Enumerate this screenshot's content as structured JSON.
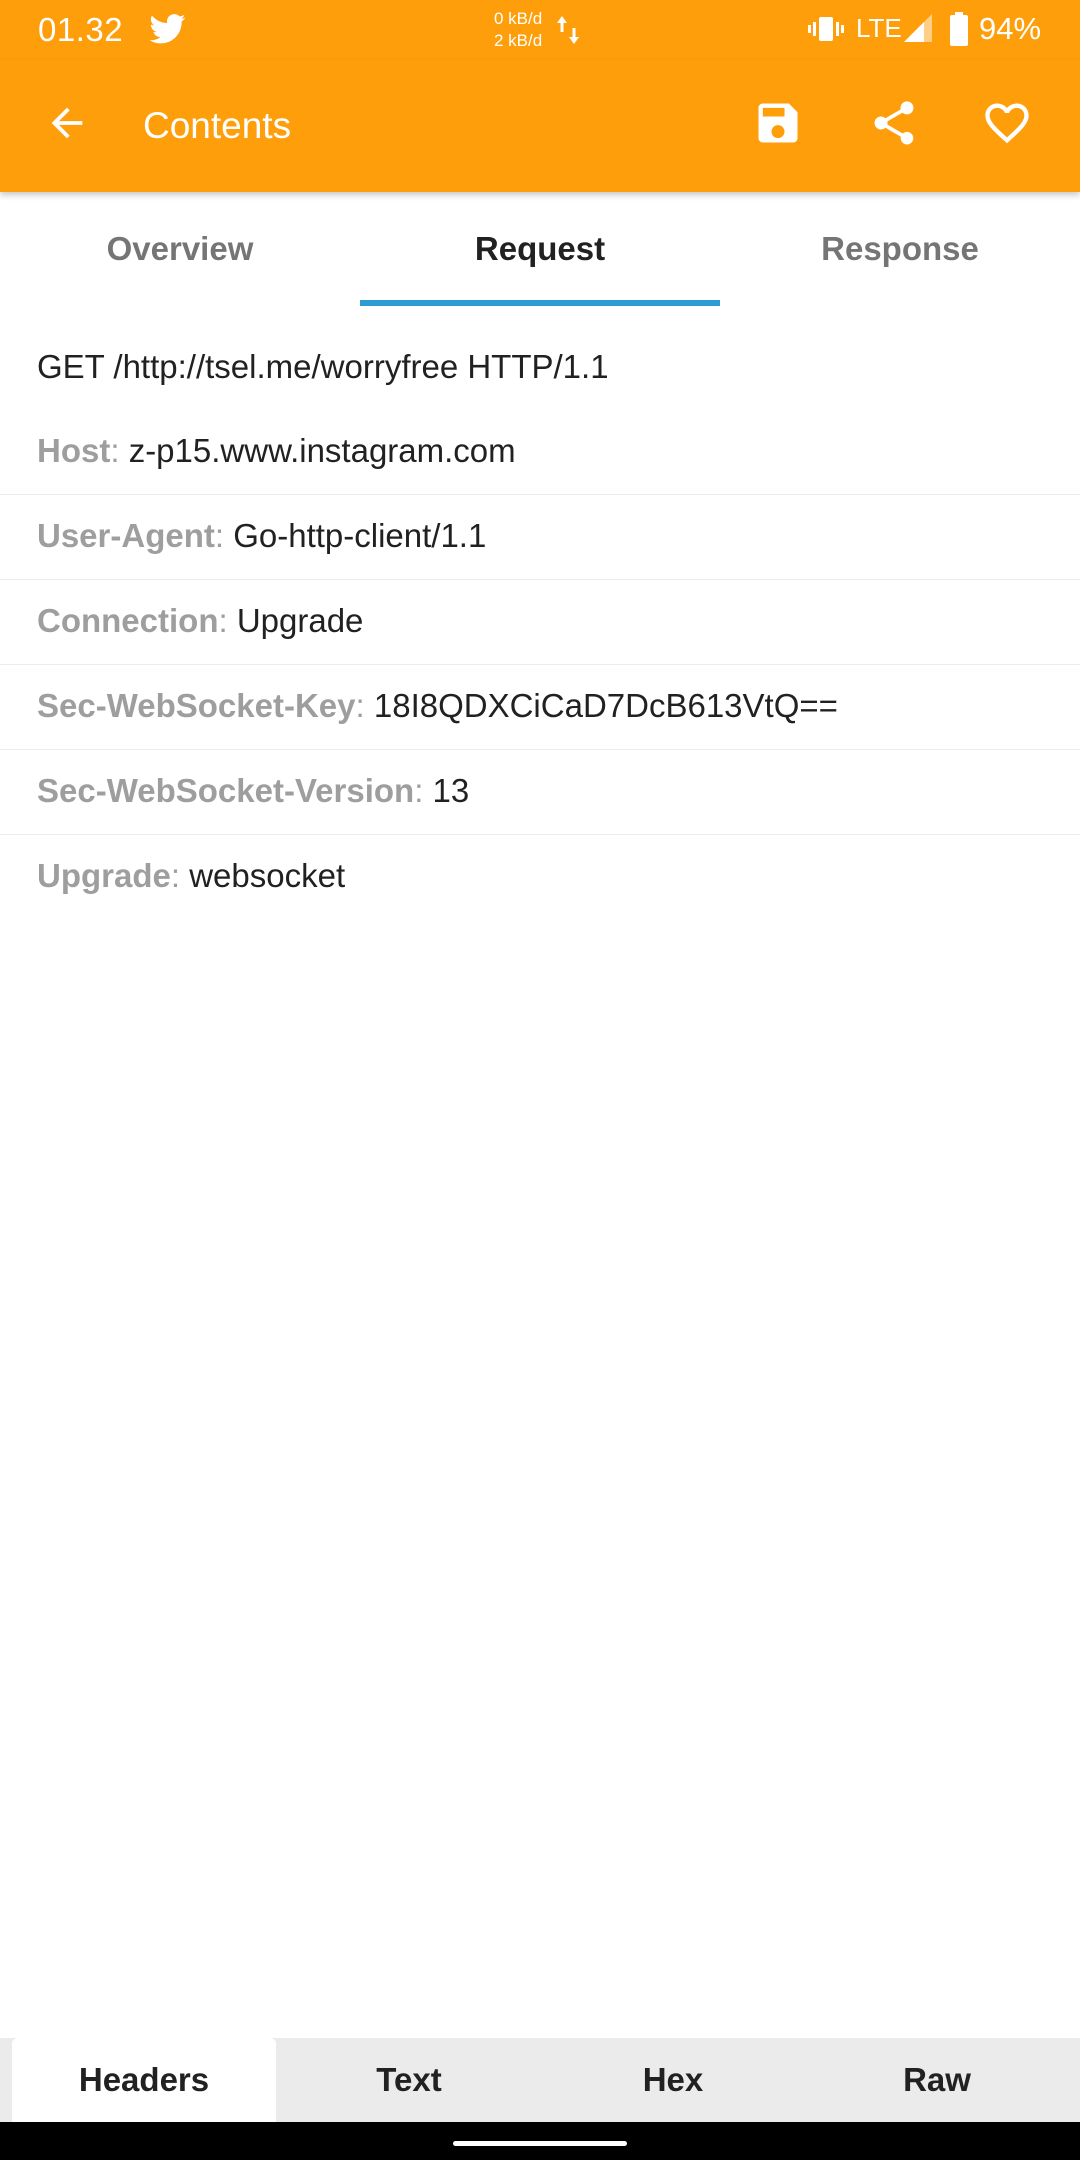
{
  "status_bar": {
    "time": "01.32",
    "speed_up": "0 kB/d",
    "speed_down": "2 kB/d",
    "network": "LTE",
    "battery": "94%",
    "icons": [
      "twitter-icon",
      "data-transfer-icon",
      "vibrate-icon",
      "signal-icon",
      "battery-icon"
    ]
  },
  "app_bar": {
    "title": "Contents",
    "icons": [
      "back-arrow-icon",
      "save-icon",
      "share-icon",
      "heart-icon"
    ]
  },
  "tabs": {
    "items": [
      "Overview",
      "Request",
      "Response"
    ],
    "active": "Request"
  },
  "request": {
    "request_line": "GET /http://tsel.me/worryfree HTTP/1.1",
    "headers": [
      {
        "name": "Host",
        "value": "z-p15.www.instagram.com"
      },
      {
        "name": "User-Agent",
        "value": "Go-http-client/1.1"
      },
      {
        "name": "Connection",
        "value": "Upgrade"
      },
      {
        "name": "Sec-WebSocket-Key",
        "value": "18I8QDXCiCaD7DcB613VtQ=="
      },
      {
        "name": "Sec-WebSocket-Version",
        "value": "13"
      },
      {
        "name": "Upgrade",
        "value": "websocket"
      }
    ],
    "separator": ": "
  },
  "bottom_tabs": {
    "items": [
      "Headers",
      "Text",
      "Hex",
      "Raw"
    ],
    "active": "Headers"
  },
  "colors": {
    "accent": "#ff9e0b",
    "tab_indicator": "#2e9bd2",
    "header_name": "#9e9e9e"
  }
}
